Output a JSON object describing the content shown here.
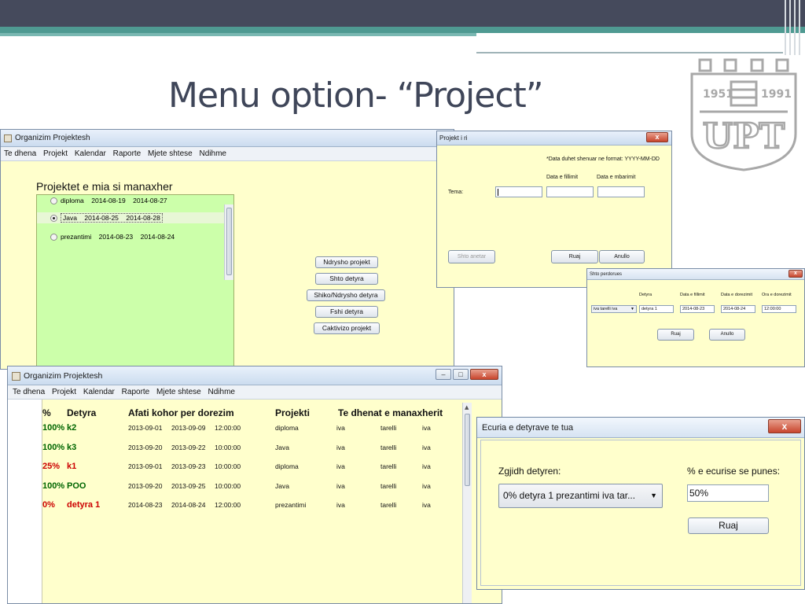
{
  "slide": {
    "title": "Menu option- “Project”"
  },
  "logo": {
    "text": "UPT",
    "years": [
      "1951",
      "1991"
    ]
  },
  "window_main": {
    "title": "Organizim Projektesh",
    "menu": [
      "Te dhena",
      "Projekt",
      "Kalendar",
      "Raporte",
      "Mjete shtese",
      "Ndihme"
    ],
    "heading": "Projektet e mia si manaxher",
    "projects": [
      {
        "name": "diploma",
        "start": "2014-08-19",
        "end": "2014-08-27",
        "selected": false
      },
      {
        "name": "Java",
        "start": "2014-08-25",
        "end": "2014-08-28",
        "selected": true
      },
      {
        "name": "prezantimi",
        "start": "2014-08-23",
        "end": "2014-08-24",
        "selected": false
      }
    ],
    "buttons": [
      "Ndrysho projekt",
      "Shto    detyra",
      "Shiko/Ndrysho  detyra",
      "Fshi    detyra",
      "Caktivizo projekt"
    ]
  },
  "window_new_project": {
    "title": "Projekt i ri",
    "date_hint": "*Data duhet shenuar ne format: YYYY-MM-DD",
    "col_start": "Data e fillimit",
    "col_end": "Data e mbarimit",
    "tema_label": "Tema:",
    "tema_value": "",
    "start_value": "",
    "end_value": "",
    "add_members_label": "Shto anetar",
    "save_label": "Ruaj",
    "cancel_label": "Anullo"
  },
  "window_add_user": {
    "title": "Shto perdorues",
    "col_task": "Detyra",
    "col_start": "Data e fillimit",
    "col_end": "Data e dorezimit",
    "col_time": "Ora e dorezimit",
    "user_value": "iva tarelli iva",
    "task_value": "detyra 1",
    "start_value": "2014-08-23",
    "end_value": "2014-08-24",
    "time_value": "12:00:00",
    "save_label": "Ruaj",
    "cancel_label": "Anullo"
  },
  "window_tasks": {
    "title": "Organizim Projektesh",
    "menu": [
      "Te dhena",
      "Projekt",
      "Kalendar",
      "Raporte",
      "Mjete shtese",
      "Ndihme"
    ],
    "headers": {
      "pct": "%",
      "task": "Detyra",
      "deadline": "Afati kohor per dorezim",
      "project": "Projekti",
      "manager": "Te dhenat e manaxherit"
    },
    "rows": [
      {
        "pct": "100%",
        "task": "k2",
        "start": "2013-09-01",
        "end": "2013-09-09",
        "time": "12:00:00",
        "project": "diploma",
        "m1": "iva",
        "m2": "tarelli",
        "m3": "iva",
        "color": "#006600"
      },
      {
        "pct": "100%",
        "task": "k3",
        "start": "2013-09-20",
        "end": "2013-09-22",
        "time": "10:00:00",
        "project": "Java",
        "m1": "iva",
        "m2": "tarelli",
        "m3": "iva",
        "color": "#006600"
      },
      {
        "pct": "25%",
        "task": "k1",
        "start": "2013-09-01",
        "end": "2013-09-23",
        "time": "10:00:00",
        "project": "diploma",
        "m1": "iva",
        "m2": "tarelli",
        "m3": "iva",
        "color": "#cc0000"
      },
      {
        "pct": "100%",
        "task": "POO",
        "start": "2013-09-20",
        "end": "2013-09-25",
        "time": "10:00:00",
        "project": "Java",
        "m1": "iva",
        "m2": "tarelli",
        "m3": "iva",
        "color": "#006600"
      },
      {
        "pct": "0%",
        "task": "detyra 1",
        "start": "2014-08-23",
        "end": "2014-08-24",
        "time": "12:00:00",
        "project": "prezantimi",
        "m1": "iva",
        "m2": "tarelli",
        "m3": "iva",
        "color": "#cc0000"
      }
    ]
  },
  "window_progress": {
    "title": "Ecuria e detyrave te tua",
    "choose_label": "Zgjidh detyren:",
    "choose_value": "0% detyra 1 prezantimi iva tar...",
    "progress_label": "% e ecurise se punes:",
    "progress_value": "50%",
    "save_label": "Ruaj"
  }
}
